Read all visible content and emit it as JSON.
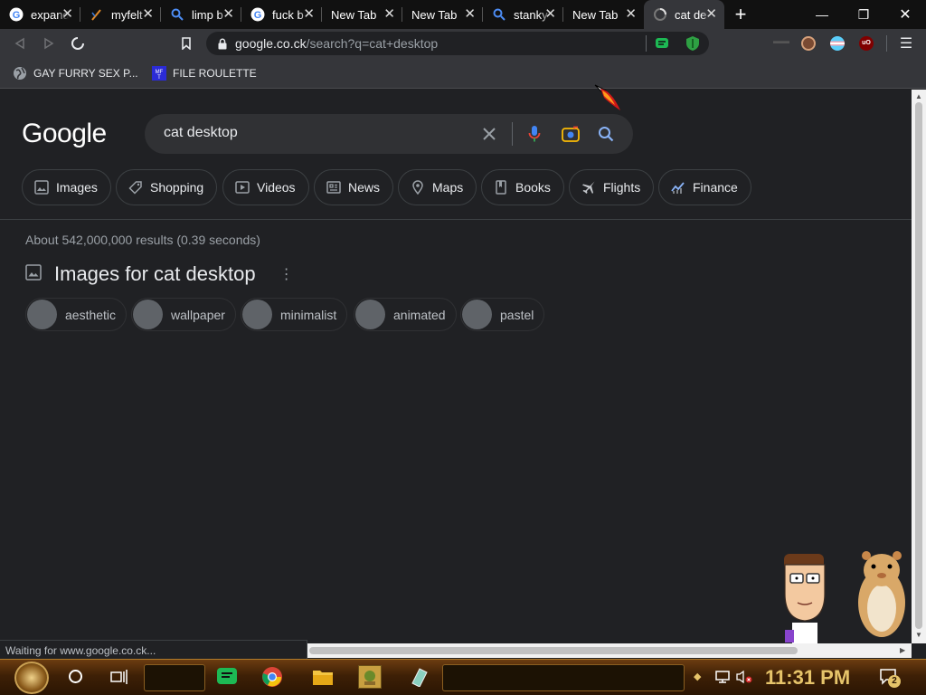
{
  "browser": {
    "tabs": [
      {
        "title": "expand",
        "icon": "google-icon"
      },
      {
        "title": "myfelt",
        "icon": "feather-icon"
      },
      {
        "title": "limp b",
        "icon": "search-icon"
      },
      {
        "title": "fuck b",
        "icon": "google-icon"
      },
      {
        "title": "New Tab",
        "icon": ""
      },
      {
        "title": "New Tab",
        "icon": ""
      },
      {
        "title": "stanky",
        "icon": "search-icon"
      },
      {
        "title": "New Tab",
        "icon": ""
      },
      {
        "title": "cat de",
        "icon": "loading-icon",
        "active": true
      }
    ],
    "url_host": "google.co.ck",
    "url_path": "/search?q=cat+desktop",
    "bookmarks": [
      {
        "label": "GAY FURRY SEX P...",
        "icon": "globe-icon"
      },
      {
        "label": "FILE ROULETTE",
        "icon": "mf-icon"
      }
    ],
    "status": "Waiting for www.google.co.ck..."
  },
  "google": {
    "logo": "Google",
    "query": "cat desktop",
    "chips": [
      "Images",
      "Shopping",
      "Videos",
      "News",
      "Maps",
      "Books",
      "Flights",
      "Finance"
    ],
    "stats": "About 542,000,000 results (0.39 seconds)",
    "images_heading": "Images for cat desktop",
    "refinements": [
      "aesthetic",
      "wallpaper",
      "minimalist",
      "animated",
      "pastel"
    ]
  },
  "taskbar": {
    "clock": "11:31 PM",
    "notification_count": "2"
  },
  "colors": {
    "page_bg": "#202124",
    "accent_blue": "#8ab4f8",
    "clock_gold": "#e6c46a"
  }
}
